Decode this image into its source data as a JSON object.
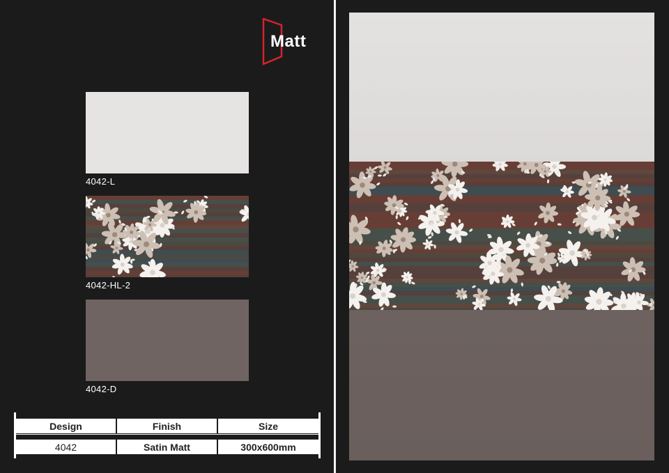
{
  "brand": {
    "finish_label": "Matt",
    "accent_color": "#d3242a"
  },
  "swatches": [
    {
      "code": "4042-L",
      "tone": "light",
      "color": "#e6e3e3"
    },
    {
      "code": "4042-HL-2",
      "tone": "floral decor",
      "color": "#4f4340"
    },
    {
      "code": "4042-D",
      "tone": "dark",
      "color": "#6f6461"
    }
  ],
  "spec_table": {
    "headers": [
      "Design",
      "Finish",
      "Size"
    ],
    "values": [
      "4042",
      "Satin Matt",
      "300x600mm"
    ]
  }
}
